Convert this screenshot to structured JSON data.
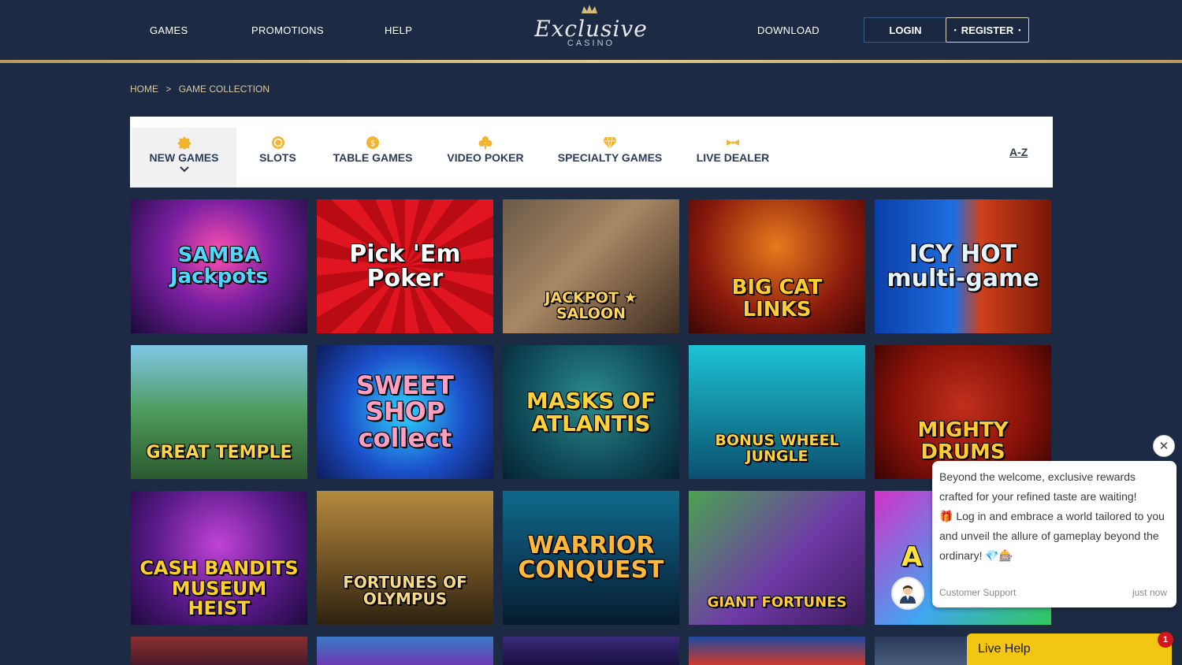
{
  "header": {
    "nav_left": [
      "GAMES",
      "PROMOTIONS",
      "HELP"
    ],
    "nav_right": [
      "DOWNLOAD"
    ],
    "logo_script": "Exclusive",
    "logo_sub": "CASINO",
    "login_label": "LOGIN",
    "register_label": "REGISTER",
    "register_dot": "•"
  },
  "breadcrumb": {
    "home": "HOME",
    "separator": ">",
    "current": "GAME COLLECTION"
  },
  "tabs": [
    {
      "label": "NEW GAMES",
      "icon": "new-games-icon"
    },
    {
      "label": "SLOTS",
      "icon": "slots-icon"
    },
    {
      "label": "TABLE GAMES",
      "icon": "table-games-icon"
    },
    {
      "label": "VIDEO POKER",
      "icon": "video-poker-icon"
    },
    {
      "label": "SPECIALTY GAMES",
      "icon": "specialty-games-icon"
    },
    {
      "label": "LIVE DEALER",
      "icon": "live-dealer-icon"
    }
  ],
  "az_label": "A-Z",
  "games": [
    {
      "title": "SAMBA Jackpots"
    },
    {
      "title": "Pick 'Em Poker"
    },
    {
      "title": "JACKPOT ★ SALOON"
    },
    {
      "title": "BIG CAT LINKS"
    },
    {
      "title": "ICY HOT multi-game"
    },
    {
      "title": "GREAT TEMPLE"
    },
    {
      "title": "SWEET SHOP collect"
    },
    {
      "title": "MASKS OF ATLANTIS"
    },
    {
      "title": "BONUS WHEEL JUNGLE"
    },
    {
      "title": "MIGHTY DRUMS"
    },
    {
      "title": "CASH BANDITS MUSEUM HEIST"
    },
    {
      "title": "FORTUNES OF OLYMPUS"
    },
    {
      "title": "WARRIOR CONQUEST"
    },
    {
      "title": "GIANT FORTUNES"
    },
    {
      "title": "A"
    }
  ],
  "chat": {
    "close": "✕",
    "line1": "Beyond the welcome, exclusive rewards crafted for your refined taste are waiting!",
    "line2": "Log in and embrace a world tailored to you and unveil the allure of gameplay beyond the ordinary!",
    "gift_emoji": "🎁",
    "end_emoji": "💎🎰",
    "sender": "Customer Support",
    "time": "just now"
  },
  "live_help": {
    "label": "Live Help",
    "badge": "1"
  },
  "colors": {
    "bg": "#1c2a44",
    "gold": "#e0c98a",
    "tab_text": "#2b3c5a",
    "live_help": "#f3c614"
  }
}
